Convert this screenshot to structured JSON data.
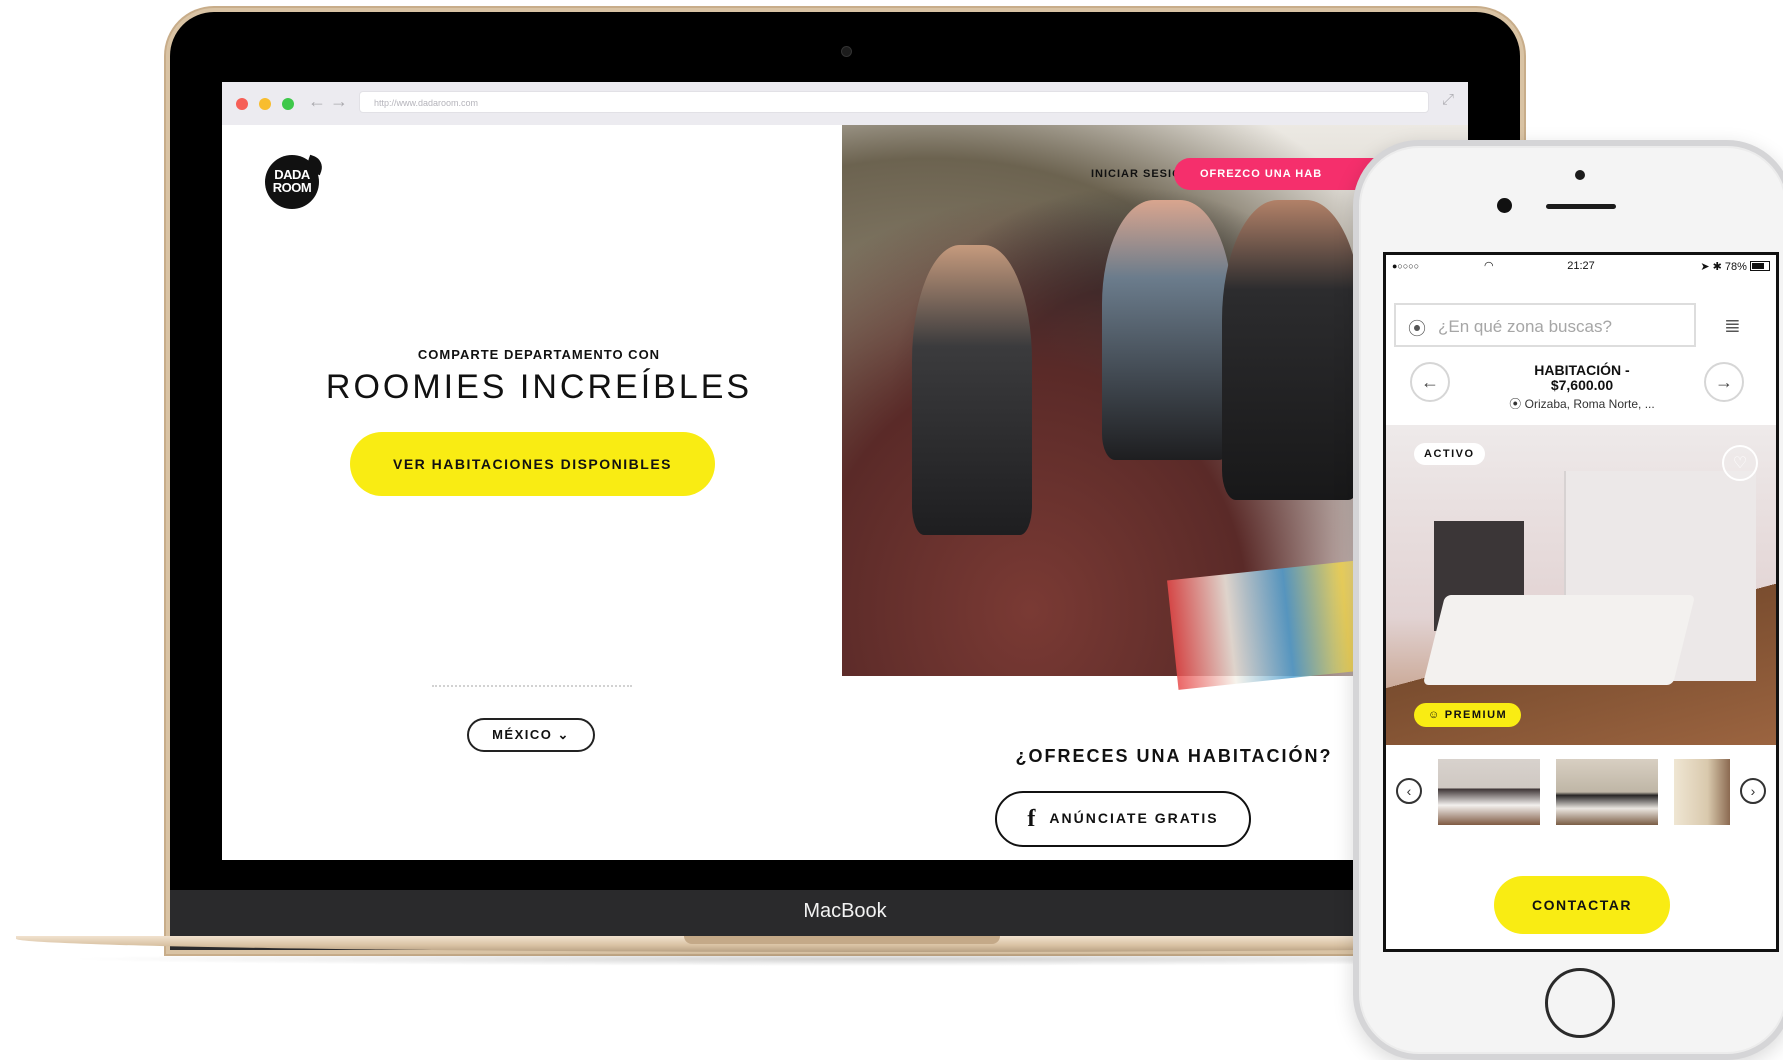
{
  "browser": {
    "url": "http://www.dadaroom.com"
  },
  "site": {
    "logo_line1": "DADA",
    "logo_line2": "ROOM",
    "login_link": "INICIAR SESIÓN",
    "offer_button": "OFREZCO UNA HAB",
    "hero_kicker": "COMPARTE DEPARTAMENTO CON",
    "hero_title": "ROOMIES INCREÍBLES",
    "hero_cta": "VER HABITACIONES DISPONIBLES",
    "country_select": "MÉXICO ⌄",
    "offer_question": "¿OFRECES UNA HABITACIÓN?",
    "facebook_button": "ANÚNCIATE GRATIS",
    "facebook_icon": "f"
  },
  "laptop": {
    "label": "MacBook"
  },
  "phone": {
    "status": {
      "carrier": "●○○○○",
      "time": "21:27",
      "battery": "78%"
    },
    "search_placeholder": "¿En qué zona buscas?",
    "listing": {
      "title_line1": "HABITACIÓN -",
      "title_line2": "$7,600.00",
      "location": "Orizaba, Roma Norte, ..."
    },
    "badge_active": "ACTIVO",
    "badge_premium": "PREMIUM",
    "contact_button": "CONTACTAR"
  },
  "icons": {
    "browser_back": "arrow-left",
    "browser_forward": "arrow-right",
    "expand": "expand",
    "location_pin": "map-pin",
    "list": "list",
    "heart": "heart",
    "prev": "arrow-left",
    "next": "arrow-right"
  },
  "colors": {
    "brand_yellow": "#f9ec13",
    "brand_pink": "#f52f6c",
    "text_dark": "#111111"
  }
}
